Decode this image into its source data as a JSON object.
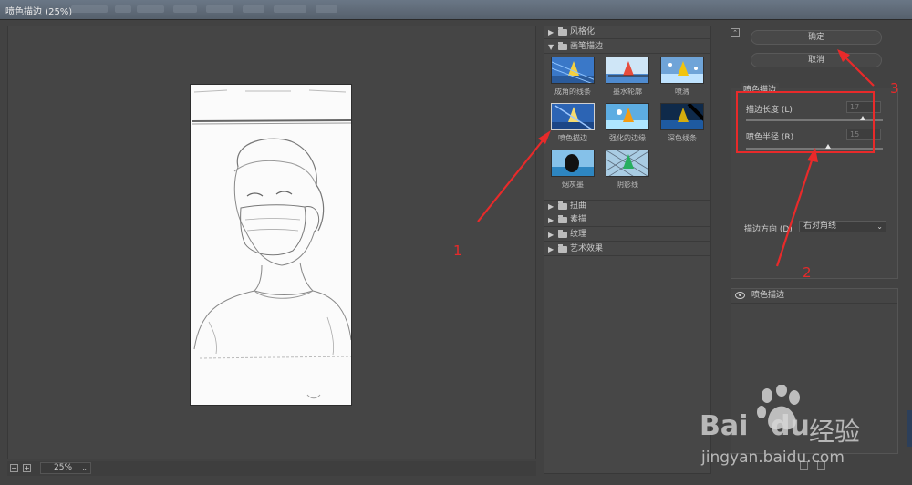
{
  "window": {
    "title": "喷色描边 (25%)"
  },
  "preview": {
    "zoom": "25%",
    "minus": "−",
    "plus": "+"
  },
  "gallery": {
    "categories": [
      {
        "label": "风格化",
        "expanded": false
      },
      {
        "label": "画笔描边",
        "expanded": true
      },
      {
        "label": "扭曲",
        "expanded": false
      },
      {
        "label": "素描",
        "expanded": false
      },
      {
        "label": "纹理",
        "expanded": false
      },
      {
        "label": "艺术效果",
        "expanded": false
      }
    ],
    "filters": [
      {
        "label": "成角的线条"
      },
      {
        "label": "墨水轮廓"
      },
      {
        "label": "喷溅"
      },
      {
        "label": "喷色描边",
        "selected": true
      },
      {
        "label": "强化的边缘"
      },
      {
        "label": "深色线条"
      },
      {
        "label": "烟灰墨"
      },
      {
        "label": "阴影线"
      }
    ]
  },
  "right": {
    "ok_label": "确定",
    "cancel_label": "取消",
    "settings_title": "喷色描边",
    "stroke_length": {
      "label": "描边长度 (L)",
      "value": "17",
      "fraction": 0.85
    },
    "spray_radius": {
      "label": "喷色半径 (R)",
      "value": "15",
      "fraction": 0.6
    },
    "direction": {
      "label": "描边方向 (D)",
      "value": "右对角线"
    },
    "layer_name": "喷色描边"
  },
  "annotations": {
    "n1": "1",
    "n2": "2",
    "n3": "3"
  },
  "watermark": {
    "brand": "Bai",
    "brand2": "du",
    "cn": "经验",
    "url": "jingyan.baidu.com"
  },
  "colors": {
    "annotation": "#e82a2a",
    "panel": "#454545",
    "selected_border": "#d0d0d0"
  }
}
